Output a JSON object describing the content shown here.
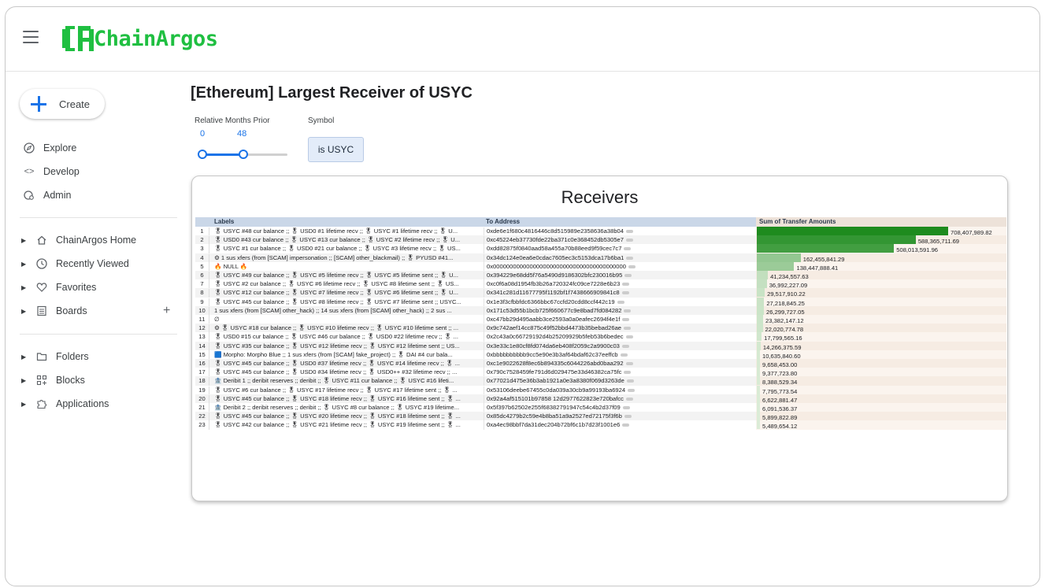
{
  "app": {
    "brand": "ChainArgos",
    "brand_color": "#1fbf41",
    "accent_color": "#1a73e8"
  },
  "sidebar": {
    "create_label": "Create",
    "primary": [
      {
        "label": "Explore",
        "icon": "compass-icon"
      },
      {
        "label": "Develop",
        "icon": "code-icon"
      },
      {
        "label": "Admin",
        "icon": "admin-gear-icon"
      }
    ],
    "secondary": [
      {
        "label": "ChainArgos Home",
        "icon": "home-icon"
      },
      {
        "label": "Recently Viewed",
        "icon": "clock-icon"
      },
      {
        "label": "Favorites",
        "icon": "heart-icon"
      },
      {
        "label": "Boards",
        "icon": "board-icon"
      }
    ],
    "tertiary": [
      {
        "label": "Folders",
        "icon": "folder-icon"
      },
      {
        "label": "Blocks",
        "icon": "blocks-icon"
      },
      {
        "label": "Applications",
        "icon": "puzzle-icon"
      }
    ]
  },
  "dashboard": {
    "title": "[Ethereum] Largest Receiver of USYC",
    "filters": {
      "months_label": "Relative Months Prior",
      "months_min": "0",
      "months_max": "48",
      "symbol_label": "Symbol",
      "symbol_value": "is USYC"
    }
  },
  "table": {
    "title": "Receivers",
    "headers": {
      "labels": "Labels",
      "address": "To Address",
      "sum": "Sum of Transfer Amounts"
    },
    "bar_color_max": "#1e8b1e",
    "bar_color_min": "#e6f2e2",
    "max_value": 708407989.82,
    "rows": [
      {
        "i": "1",
        "labels": "🎖 USYC #48 cur balance ;; 🎖 USD0 #1 lifetime recv ;; 🎖 USYC #1 lifetime recv ;; 🎖 U...",
        "addr": "0xde6e1f680c4816446c8d515989e2358636a38b04",
        "value": 708407989.82,
        "display": "708,407,989.82"
      },
      {
        "i": "2",
        "labels": "🎖 USD0 #43 cur balance ;; 🎖 USYC #13 cur balance ;; 🎖 USYC #2 lifetime recv ;; 🎖 U...",
        "addr": "0xc45224eb37730fde22ba371c0e368452db5305e7",
        "value": 588365711.69,
        "display": "588,365,711.69"
      },
      {
        "i": "3",
        "labels": "🎖 USYC #1 cur balance ;; 🎖 USD0 #21 cur balance ;; 🎖 USYC #3 lifetime recv ;; 🎖 US...",
        "addr": "0xdd82875f0840aad58a455a70b88eed9f59cec7c7",
        "value": 508013591.96,
        "display": "508,013,591.96"
      },
      {
        "i": "4",
        "labels": "⚙ 1 sus xfers (from [SCAM] impersonation ;; [SCAM] other_blackmail) ;; 🎖 PYUSD #41...",
        "addr": "0x34dc124e0ea6e0cdac7605ec3c5153dca17b6ba1",
        "value": 162455841.29,
        "display": "162,455,841.29"
      },
      {
        "i": "5",
        "labels": "🔥 NULL 🔥",
        "addr": "0x0000000000000000000000000000000000000000",
        "value": 138447888.41,
        "display": "138,447,888.41"
      },
      {
        "i": "6",
        "labels": "🎖 USYC #49 cur balance ;; 🎖 USYC #5 lifetime recv ;; 🎖 USYC #5 lifetime sent ;; 🎖 U...",
        "addr": "0x394229e68dd5f76a5490d9186302bfc230016b95",
        "value": 41234557.63,
        "display": "41,234,557.63"
      },
      {
        "i": "7",
        "labels": "🎖 USYC #2 cur balance ;; 🎖 USYC #6 lifetime recv ;; 🎖 USYC #8 lifetime sent ;; 🎖 US...",
        "addr": "0xc0f6a08d1954fb3b26a720324fc09ce7228e6b23",
        "value": 36992227.09,
        "display": "36,992,227.09"
      },
      {
        "i": "8",
        "labels": "🎖 USYC #12 cur balance ;; 🎖 USYC #7 lifetime recv ;; 🎖 USYC #6 lifetime sent ;; 🎖 U...",
        "addr": "0x341c281d11677795f1192bf1f7438666909841c8",
        "value": 29517910.22,
        "display": "29,517,910.22"
      },
      {
        "i": "9",
        "labels": "🎖 USYC #45 cur balance ;; 🎖 USYC #8 lifetime recv ;; 🎖 USYC #7 lifetime sent ;; USYC...",
        "addr": "0x1e3f3cfbbfdc6366bbc67ccfd20cdd8ccf442c19",
        "value": 27218845.25,
        "display": "27,218,845.25"
      },
      {
        "i": "10",
        "labels": "1 sus xfers (from [SCAM] other_hack) ;; 14 sus xfers (from [SCAM] other_hack) ;; 2 sus ...",
        "addr": "0x171c53d55b1bcb725f660677c9e8bad7fd084282",
        "value": 26299727.05,
        "display": "26,299,727.05"
      },
      {
        "i": "11",
        "labels": "∅",
        "addr": "0xc47bb29d495aabb3ce2593a0a0eafec2694f4e1f",
        "value": 23382147.12,
        "display": "23,382,147.12"
      },
      {
        "i": "12",
        "labels": "⚙ 🎖 USYC #18 cur balance ;; 🎖 USYC #10 lifetime recv ;; 🎖 USYC #10 lifetime sent ;; ...",
        "addr": "0x9c742aef14cc875c49f52bbd4473b35bebad26ae",
        "value": 22020774.78,
        "display": "22,020,774.78"
      },
      {
        "i": "13",
        "labels": "🎖 USD0 #15 cur balance ;; 🎖 USYC #46 cur balance ;; 🎖 USD0 #22 lifetime recv ;; 🎖 ...",
        "addr": "0x2c43a0c66729192d4b25209929b5feb53b6bedec",
        "value": 17799565.16,
        "display": "17,799,565.16"
      },
      {
        "i": "14",
        "labels": "🎖 USYC #35 cur balance ;; 🎖 USYC #12 lifetime recv ;; 🎖 USYC #12 lifetime sent ;; US...",
        "addr": "0x3e33c1e80cf8fd074da6eb408f2059c2a9900c03",
        "value": 14266375.59,
        "display": "14,266,375.59"
      },
      {
        "i": "15",
        "labels": "🟦 Morpho: Morpho Blue ;; 1 sus xfers (from [SCAM] fake_project) ;; 🎖 DAI #4 cur bala...",
        "addr": "0xbbbbbbbbbb9cc5e90e3b3af64bdaf62c37eeffcb",
        "value": 10635840.6,
        "display": "10,635,840.60"
      },
      {
        "i": "16",
        "labels": "🎖 USYC #45 cur balance ;; 🎖 USD0 #37 lifetime recv ;; 🎖 USYC #14 lifetime recv ;; 🎖 ...",
        "addr": "0xc1e9022628f8ec6b894335c6044226abd0baa292",
        "value": 9658453.0,
        "display": "9,658,453.00"
      },
      {
        "i": "17",
        "labels": "🎖 USYC #45 cur balance ;; 🎖 USD0 #34 lifetime recv ;; 🎖 USD0++ #32 lifetime recv ;; ...",
        "addr": "0x790c7528459fe791d6d029475e33d46382ca75fc",
        "value": 9377723.8,
        "display": "9,377,723.80"
      },
      {
        "i": "18",
        "labels": "🏦 Deribit 1 ;; deribit reserves ;; deribit ;; 🎖 USYC #11 cur balance ;; 🎖 USYC #16 lifeti...",
        "addr": "0x77021d475e36b3ab1921a0e3a8380f069d3263de",
        "value": 8388529.34,
        "display": "8,388,529.34"
      },
      {
        "i": "19",
        "labels": "🎖 USYC #6 cur balance ;; 🎖 USYC #17 lifetime recv ;; 🎖 USYC #17 lifetime sent ;; 🎖 ...",
        "addr": "0x53106deebe67455c0da039a30cb9a99193ba6924",
        "value": 7795773.54,
        "display": "7,795,773.54"
      },
      {
        "i": "20",
        "labels": "🎖 USYC #45 cur balance ;; 🎖 USYC #18 lifetime recv ;; 🎖 USYC #16 lifetime sent ;; 🎖 ...",
        "addr": "0x92a4af515101b97858 12d2977622823e720bafcc",
        "value": 6622881.47,
        "display": "6,622,881.47"
      },
      {
        "i": "21",
        "labels": "🏦 Deribit 2 ;; deribit reserves ;; deribit ;; 🎖 USYC #8 cur balance ;; 🎖 USYC #19 lifetime...",
        "addr": "0x5f397b62502e255f68382791947c54c4b2d37f09",
        "value": 6091536.37,
        "display": "6,091,536.37"
      },
      {
        "i": "22",
        "labels": "🎖 USYC #45 cur balance ;; 🎖 USYC #20 lifetime recv ;; 🎖 USYC #18 lifetime sent ;; 🎖 ...",
        "addr": "0x85dc4279b2c59e4b8ba51a9a2527ed72175f3f6b",
        "value": 5899822.89,
        "display": "5,899,822.89"
      },
      {
        "i": "23",
        "labels": "🎖 USYC #42 cur balance ;; 🎖 USYC #21 lifetime recv ;; 🎖 USYC #19 lifetime sent ;; 🎖 ...",
        "addr": "0xa4ec98bbf7da31dec204b72bf6c1b7d23f1001e6",
        "value": 5489654.12,
        "display": "5,489,654.12"
      }
    ]
  }
}
